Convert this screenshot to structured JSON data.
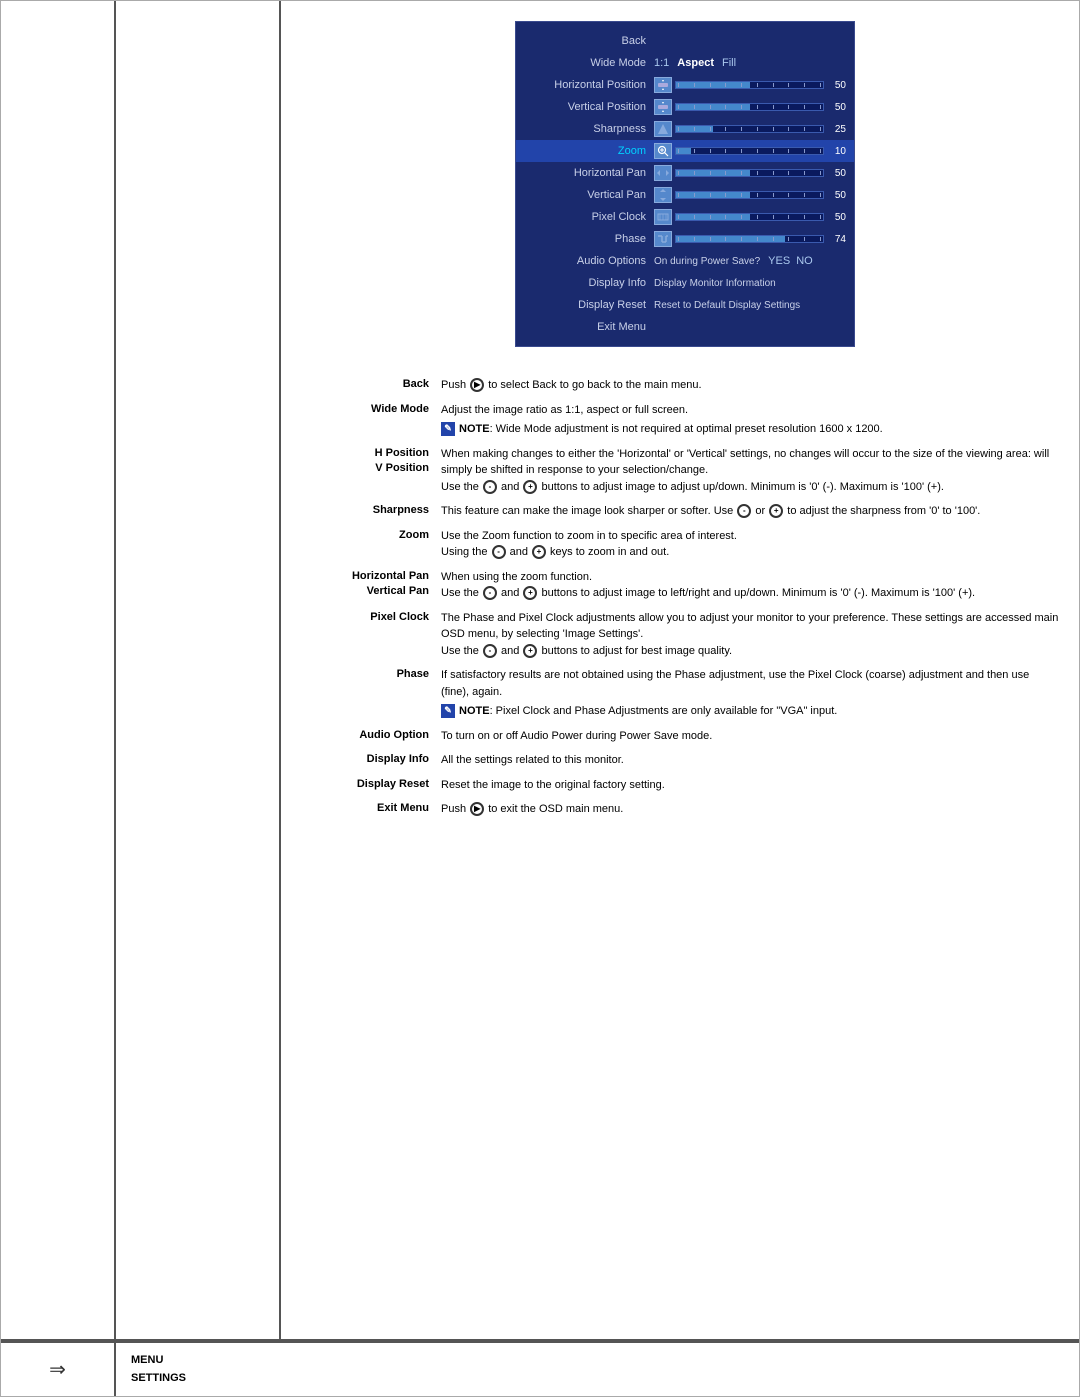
{
  "osd": {
    "rows": [
      {
        "label": "Back",
        "type": "label-only",
        "active": false
      },
      {
        "label": "Wide Mode",
        "type": "wide-mode",
        "options": [
          "1:1",
          "Aspect",
          "Fill"
        ],
        "active": false
      },
      {
        "label": "Horizontal Position",
        "type": "slider",
        "value": 50,
        "iconColor": "#5588cc",
        "active": false
      },
      {
        "label": "Vertical Position",
        "type": "slider",
        "value": 50,
        "iconColor": "#5588cc",
        "active": false
      },
      {
        "label": "Sharpness",
        "type": "slider",
        "value": 25,
        "iconColor": "#5588cc",
        "active": false
      },
      {
        "label": "Zoom",
        "type": "slider",
        "value": 10,
        "iconColor": "#5588cc",
        "active": true
      },
      {
        "label": "Horizontal Pan",
        "type": "slider",
        "value": 50,
        "iconColor": "#5588cc",
        "active": false
      },
      {
        "label": "Vertical Pan",
        "type": "slider",
        "value": 50,
        "iconColor": "#5588cc",
        "active": false
      },
      {
        "label": "Pixel Clock",
        "type": "slider",
        "value": 50,
        "iconColor": "#5588cc",
        "active": false
      },
      {
        "label": "Phase",
        "type": "slider",
        "value": 74,
        "iconColor": "#5588cc",
        "active": false
      },
      {
        "label": "Audio Options",
        "type": "audio-options",
        "active": false
      },
      {
        "label": "Display Info",
        "type": "display-info",
        "active": false
      },
      {
        "label": "Display Reset",
        "type": "display-reset",
        "active": false
      },
      {
        "label": "Exit Menu",
        "type": "label-only",
        "active": false
      }
    ]
  },
  "descriptions": [
    {
      "label": "Back",
      "lines": [
        "Push Ⓐ to select Back to go back to the main menu."
      ],
      "note": null
    },
    {
      "label": "Wide Mode",
      "lines": [
        "Adjust the image ratio as 1:1, aspect or full screen."
      ],
      "note": "NOTE: Wide Mode adjustment is not required at optimal preset resolution 1600 x 1200."
    },
    {
      "label": "H Position\nV Position",
      "lines": [
        "When making changes to either the 'Horizontal' or 'Vertical' settings, no changes will occur to the size of the viewing area: will simply be shifted in response to your selection/change.",
        "Use the ⓘ and ⓘ buttons to adjust image to adjust up/down. Minimum is '0' (-). Maximum is '100' (+)."
      ],
      "note": null
    },
    {
      "label": "Sharpness",
      "lines": [
        "This feature can make the image look sharper or softer. Use ⓘ or ⓘ to adjust the sharpness from '0' to '100'."
      ],
      "note": null
    },
    {
      "label": "Zoom",
      "lines": [
        "Use the Zoom function to zoom in to specific area of interest.",
        "Using the ⓘ and ⓘ keys to zoom in and out."
      ],
      "note": null
    },
    {
      "label": "Horizontal Pan\nVertical Pan",
      "lines": [
        "When using the zoom function.",
        "Use the ⓘ and ⓘ buttons to adjust image to left/right and up/down. Minimum is '0' (-). Maximum is '100' (+)."
      ],
      "note": null
    },
    {
      "label": "Pixel Clock",
      "lines": [
        "The Phase and Pixel Clock adjustments allow you to adjust your monitor to your preference. These settings are accessed main OSD menu, by selecting 'Image Settings'.",
        "Use the ⓘ and ⓘ buttons to adjust for best image quality."
      ],
      "note": null
    },
    {
      "label": "Phase",
      "lines": [
        "If satisfactory results are not obtained using the Phase adjustment, use the Pixel Clock (coarse) adjustment and then use (fine), again."
      ],
      "note": "NOTE: Pixel Clock and Phase Adjustments are only available for \"VGA\" input."
    },
    {
      "label": "Audio Option",
      "lines": [
        "To turn on or off Audio Power during Power Save mode."
      ],
      "note": null
    },
    {
      "label": "Display Info",
      "lines": [
        "All the settings related to this monitor."
      ],
      "note": null
    },
    {
      "label": "Display Reset",
      "lines": [
        "Reset the image to the original factory setting."
      ],
      "note": null
    },
    {
      "label": "Exit Menu",
      "lines": [
        "Push Ⓐ to exit the OSD main menu."
      ],
      "note": null
    }
  ],
  "footer": {
    "icon": "↳",
    "label1": "MENU",
    "label2": "SETTINGS"
  }
}
